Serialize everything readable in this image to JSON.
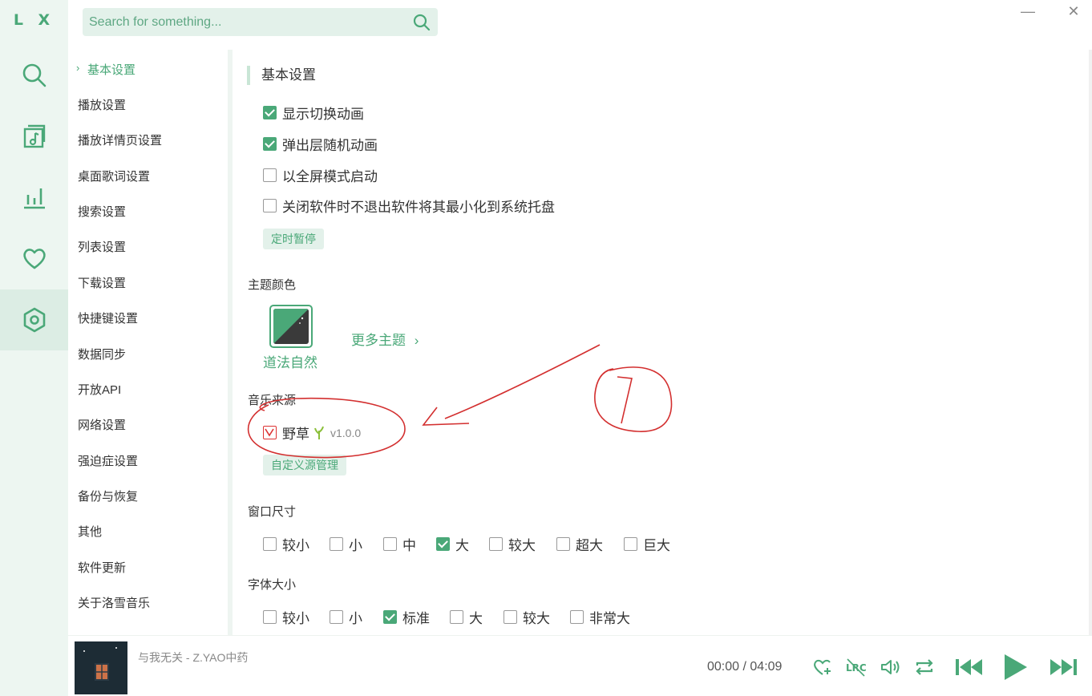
{
  "app": {
    "logo": "L X"
  },
  "search": {
    "placeholder": "Search for something..."
  },
  "window": {
    "minimize": "—",
    "close": "✕"
  },
  "rail": [
    {
      "name": "search-icon"
    },
    {
      "name": "music-list-icon"
    },
    {
      "name": "chart-icon"
    },
    {
      "name": "heart-icon"
    },
    {
      "name": "settings-icon",
      "active": true
    }
  ],
  "nav": {
    "items": [
      "基本设置",
      "播放设置",
      "播放详情页设置",
      "桌面歌词设置",
      "搜索设置",
      "列表设置",
      "下载设置",
      "快捷键设置",
      "数据同步",
      "开放API",
      "网络设置",
      "强迫症设置",
      "备份与恢复",
      "其他",
      "软件更新",
      "关于洛雪音乐"
    ],
    "active": "基本设置"
  },
  "basic": {
    "title": "基本设置",
    "options": [
      {
        "label": "显示切换动画",
        "checked": true
      },
      {
        "label": "弹出层随机动画",
        "checked": true
      },
      {
        "label": "以全屏模式启动",
        "checked": false
      },
      {
        "label": "关闭软件时不退出软件将其最小化到系统托盘",
        "checked": false
      }
    ],
    "timer_button": "定时暂停"
  },
  "theme": {
    "label": "主题颜色",
    "current": "道法自然",
    "more": "更多主题"
  },
  "source": {
    "label": "音乐来源",
    "name": "野草",
    "version": "v1.0.0",
    "manage_button": "自定义源管理"
  },
  "window_size": {
    "label": "窗口尺寸",
    "options": [
      "较小",
      "小",
      "中",
      "大",
      "较大",
      "超大",
      "巨大"
    ],
    "selected": "大"
  },
  "font_size": {
    "label": "字体大小",
    "options": [
      "较小",
      "小",
      "标准",
      "大",
      "较大",
      "非常大"
    ],
    "selected": "标准"
  },
  "player": {
    "song": "与我无关 - Z.YAO中药",
    "current_time": "00:00",
    "separator": "/",
    "total_time": "04:09"
  },
  "colors": {
    "accent": "#4aa878",
    "annotation": "#d32f2f"
  }
}
